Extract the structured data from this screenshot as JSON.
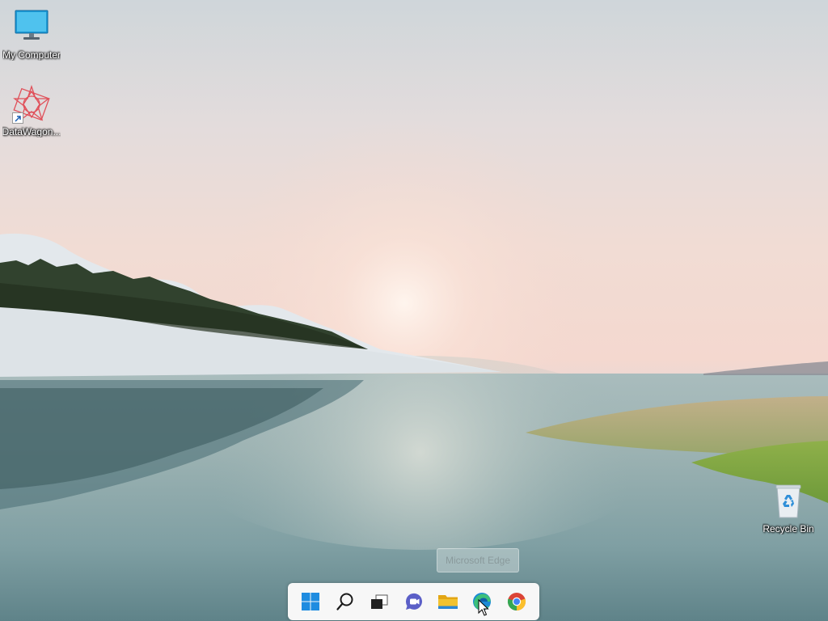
{
  "desktop": {
    "icons": [
      {
        "label": "My Computer",
        "icon": "monitor-icon"
      },
      {
        "label": "DataWagon...",
        "icon": "datawagon-app-icon"
      },
      {
        "label": "Recycle Bin",
        "icon": "recycle-bin-icon"
      }
    ]
  },
  "tooltip": {
    "text": "Microsoft Edge"
  },
  "taskbar": {
    "buttons": [
      {
        "name": "Start",
        "icon": "windows-start-icon"
      },
      {
        "name": "Search",
        "icon": "search-icon"
      },
      {
        "name": "Task View",
        "icon": "task-view-icon"
      },
      {
        "name": "Chat",
        "icon": "teams-chat-icon"
      },
      {
        "name": "File Explorer",
        "icon": "folder-icon"
      },
      {
        "name": "Microsoft Edge",
        "icon": "edge-icon"
      },
      {
        "name": "Google Chrome",
        "icon": "chrome-icon"
      }
    ]
  },
  "colors": {
    "taskbar_bg": "#f7f7f7",
    "windows_blue": "#1f8ce0",
    "folder_yellow": "#f2c230",
    "chat_purple": "#5b5fc7"
  }
}
